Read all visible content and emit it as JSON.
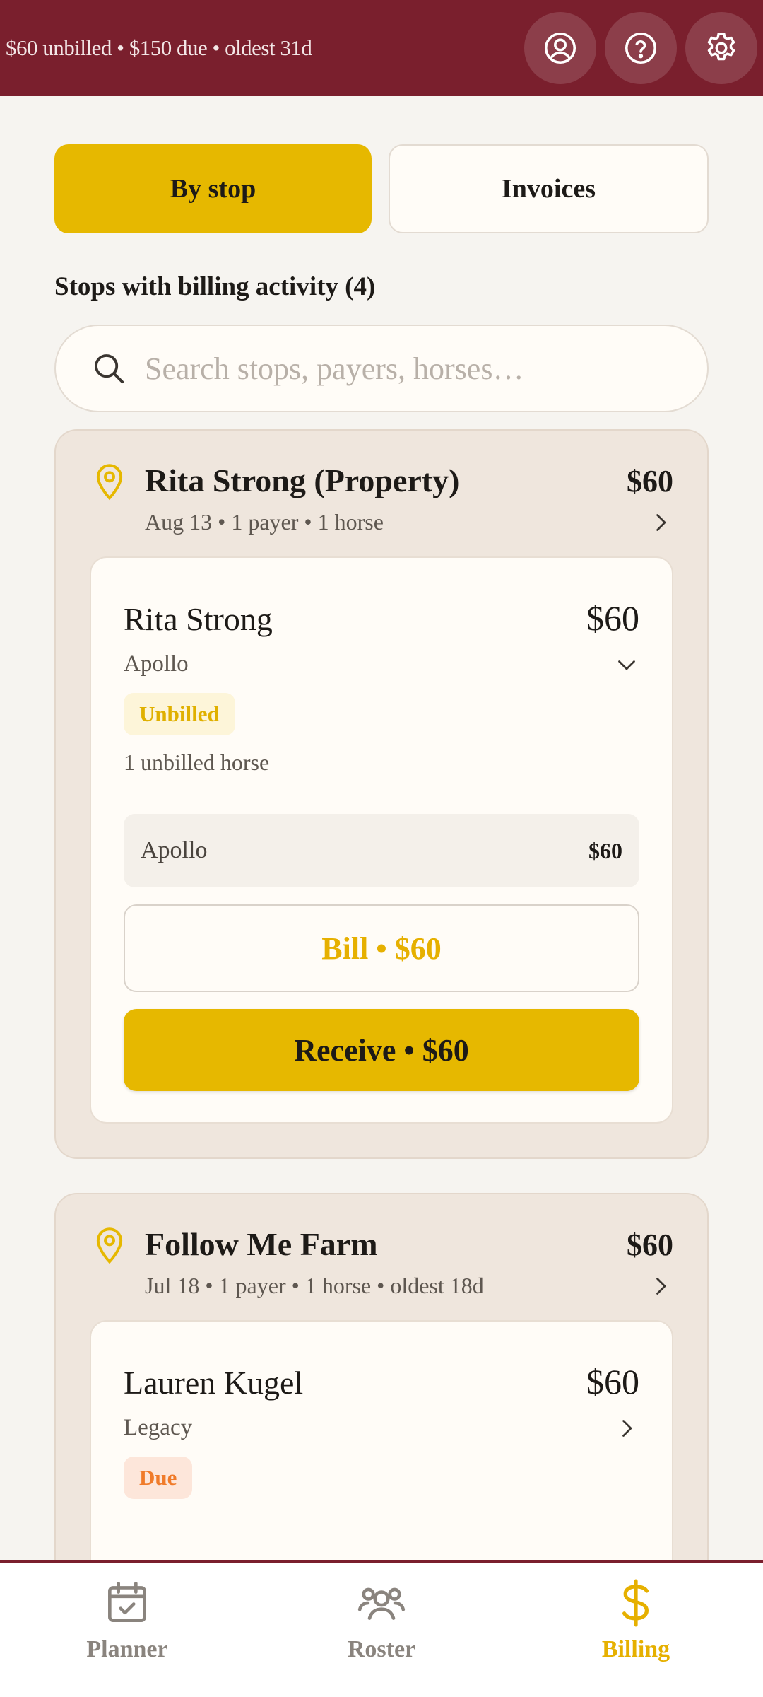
{
  "header": {
    "summary": "$60 unbilled • $150 due • oldest 31d",
    "actions": [
      "profile-icon",
      "help-icon",
      "settings-icon"
    ],
    "background": "#7a1f2d"
  },
  "segmented": {
    "by_stop": "By stop",
    "invoices": "Invoices",
    "selected": "By stop"
  },
  "section_title": "Stops with billing activity (4)",
  "search": {
    "placeholder": "Search stops, payers, horses…",
    "value": ""
  },
  "stops": [
    {
      "name": "Rita Strong (Property)",
      "amount": "$60",
      "meta": "Aug 13 • 1 payer • 1 horse",
      "payer": {
        "name": "Rita Strong",
        "amount": "$60",
        "horses": "Apollo",
        "status": "Unbilled",
        "note": "1 unbilled horse",
        "line_items": [
          {
            "name": "Apollo",
            "amount": "$60"
          }
        ],
        "bill_label": "Bill • $60",
        "receive_label": "Receive • $60"
      }
    },
    {
      "name": "Follow Me Farm",
      "amount": "$60",
      "meta": "Jul 18 • 1 payer • 1 horse • oldest 18d",
      "payer": {
        "name": "Lauren Kugel",
        "amount": "$60",
        "horses": "Legacy",
        "status": "Due"
      }
    }
  ],
  "nav": {
    "items": [
      {
        "label": "Planner",
        "icon": "calendar-check-icon"
      },
      {
        "label": "Roster",
        "icon": "users-icon"
      },
      {
        "label": "Billing",
        "icon": "dollar-icon"
      }
    ],
    "active": "Billing"
  },
  "colors": {
    "accent": "#e6b800",
    "brand": "#7a1f2d",
    "unbilled": "#e0b000",
    "due": "#f07b2a"
  }
}
